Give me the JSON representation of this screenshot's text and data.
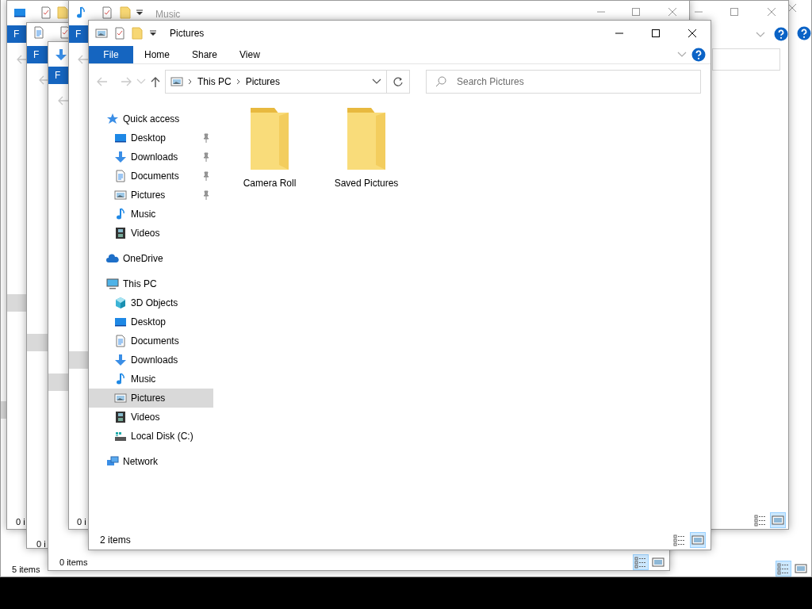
{
  "background_windows": [
    {
      "status": "5 items",
      "view_buttons": [
        {
          "kind": "details",
          "selected": true
        },
        {
          "kind": "large_icons",
          "selected": false
        }
      ]
    },
    {
      "file_tab": "F",
      "status": "0 i",
      "view_buttons": [
        {
          "kind": "details",
          "selected": false
        },
        {
          "kind": "large_icons",
          "selected": true
        }
      ]
    },
    {
      "file_tab": "F",
      "status": "0 i"
    },
    {
      "file_tab": "F",
      "status": "0 items",
      "view_buttons": [
        {
          "kind": "details",
          "selected": true
        },
        {
          "kind": "large_icons",
          "selected": false
        }
      ]
    },
    {
      "title": "Music",
      "file_tab": "F",
      "status": "0 i"
    }
  ],
  "window": {
    "title": "Pictures",
    "ribbon_tabs": [
      {
        "label": "File",
        "selected": true
      },
      {
        "label": "Home",
        "selected": false
      },
      {
        "label": "Share",
        "selected": false
      },
      {
        "label": "View",
        "selected": false
      }
    ],
    "address": [
      "This PC",
      "Pictures"
    ],
    "search": {
      "placeholder": "Search Pictures"
    },
    "navigation": [
      {
        "label": "Quick access",
        "kind": "star",
        "selected": false,
        "children": [
          {
            "label": "Desktop",
            "kind": "desktop",
            "pinned": true,
            "selected": false
          },
          {
            "label": "Downloads",
            "kind": "downloads",
            "pinned": true,
            "selected": false
          },
          {
            "label": "Documents",
            "kind": "documents",
            "pinned": true,
            "selected": false
          },
          {
            "label": "Pictures",
            "kind": "pictures",
            "pinned": true,
            "selected": false
          },
          {
            "label": "Music",
            "kind": "music",
            "pinned": false,
            "selected": false
          },
          {
            "label": "Videos",
            "kind": "videos",
            "pinned": false,
            "selected": false
          }
        ]
      },
      {
        "label": "OneDrive",
        "kind": "cloud",
        "selected": false
      },
      {
        "label": "This PC",
        "kind": "pc",
        "selected": false,
        "children": [
          {
            "label": "3D Objects",
            "kind": "cube",
            "selected": false
          },
          {
            "label": "Desktop",
            "kind": "desktop",
            "selected": false
          },
          {
            "label": "Documents",
            "kind": "documents",
            "selected": false
          },
          {
            "label": "Downloads",
            "kind": "downloads",
            "selected": false
          },
          {
            "label": "Music",
            "kind": "music",
            "selected": false
          },
          {
            "label": "Pictures",
            "kind": "pictures",
            "selected": true
          },
          {
            "label": "Videos",
            "kind": "videos",
            "selected": false
          },
          {
            "label": "Local Disk (C:)",
            "kind": "drive",
            "selected": false
          }
        ]
      },
      {
        "label": "Network",
        "kind": "network",
        "selected": false
      }
    ],
    "items": [
      {
        "label": "Camera Roll"
      },
      {
        "label": "Saved Pictures"
      }
    ],
    "status": "2 items",
    "view_buttons": [
      {
        "kind": "details",
        "selected": false
      },
      {
        "kind": "large_icons",
        "selected": true
      }
    ]
  }
}
